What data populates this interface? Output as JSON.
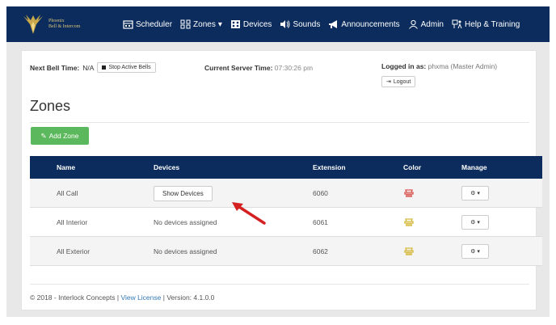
{
  "brand": {
    "line1": "Phoenix",
    "line2": "Bell & Intercom"
  },
  "nav": [
    {
      "label": "Scheduler",
      "icon": "calendar-icon"
    },
    {
      "label": "Zones",
      "icon": "zones-icon",
      "caret": "▾"
    },
    {
      "label": "Devices",
      "icon": "devices-icon"
    },
    {
      "label": "Sounds",
      "icon": "speaker-icon"
    },
    {
      "label": "Announcements",
      "icon": "megaphone-icon"
    },
    {
      "label": "Admin",
      "icon": "user-icon"
    },
    {
      "label": "Help & Training",
      "icon": "help-icon"
    }
  ],
  "status": {
    "next_bell_label": "Next Bell Time:",
    "next_bell_value": "N/A",
    "stop_button": "Stop Active Bells",
    "server_time_label": "Current Server Time:",
    "server_time_value": "07:30:26 pm",
    "logged_in_label": "Logged in as:",
    "logged_in_value": "phxma (Master Admin)",
    "logout": "Logout"
  },
  "page": {
    "title": "Zones",
    "add_button": "Add Zone"
  },
  "table": {
    "headers": {
      "name": "Name",
      "devices": "Devices",
      "extension": "Extension",
      "color": "Color",
      "manage": "Manage"
    },
    "rows": [
      {
        "name": "All Call",
        "devices": "Show Devices",
        "extension": "6060",
        "color": "#d9534f"
      },
      {
        "name": "All Interior",
        "devices": "No devices assigned",
        "extension": "6061",
        "color": "#d4b93a"
      },
      {
        "name": "All Exterior",
        "devices": "No devices assigned",
        "extension": "6062",
        "color": "#d4b93a"
      }
    ]
  },
  "footer": {
    "copyright": "© 2018 - Interlock Concepts |",
    "license_link": "View License",
    "version": "| Version: 4.1.0.0"
  },
  "colors": {
    "navbar": "#0b2c5c",
    "add_button": "#5cb85c",
    "arrow": "#d42020",
    "link": "#337ab7"
  }
}
